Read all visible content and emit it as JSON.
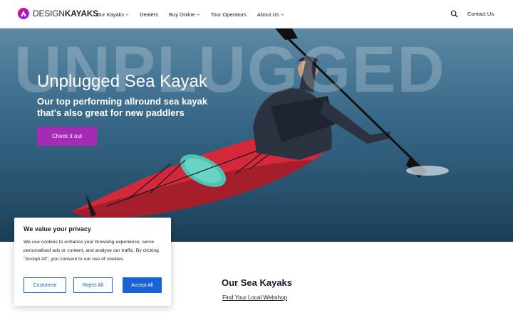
{
  "header": {
    "logo_light": "DESIGN",
    "logo_bold": "KAYAKS",
    "nav": [
      {
        "label": "Our Kayaks",
        "dropdown": true
      },
      {
        "label": "Dealers",
        "dropdown": false
      },
      {
        "label": "Buy Online",
        "dropdown": true
      },
      {
        "label": "Tour Operators",
        "dropdown": false
      },
      {
        "label": "About Us",
        "dropdown": true
      }
    ],
    "search_icon": "search-icon",
    "contact_label": "Contact Us"
  },
  "hero": {
    "background_word": "UNPLUGGED",
    "title": "Unplugged Sea Kayak",
    "subtitle": "Our top performing allround sea kayak that's also great for new paddlers",
    "cta_label": "Check it out",
    "cta_color": "#a42bb5"
  },
  "section": {
    "title": "Our Sea Kayaks",
    "link": "Find Your Local Webshop"
  },
  "cookie": {
    "title": "We value your privacy",
    "text": "We use cookies to enhance your browsing experience, serve personalised ads or content, and analyse our traffic. By clicking \"Accept All\", you consent to our use of cookies.",
    "customise_label": "Customise",
    "reject_label": "Reject All",
    "accept_label": "Accept All",
    "accent_color": "#1a63d6"
  }
}
